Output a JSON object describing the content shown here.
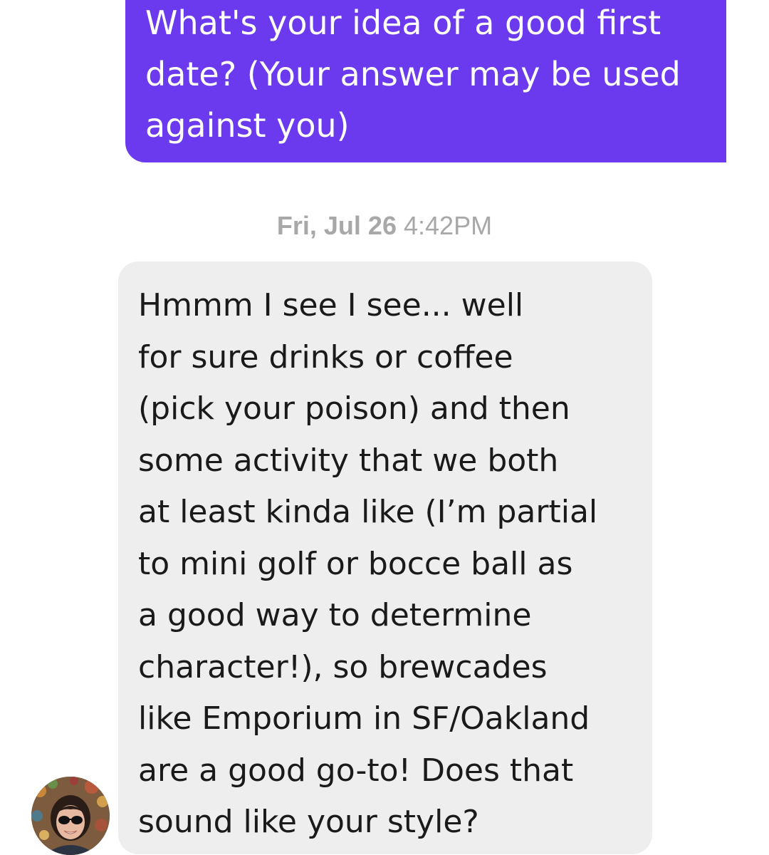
{
  "conversation": {
    "sent_message": {
      "text": "What's your idea of a good first\ndate? (Your answer may be used\nagainst you)"
    },
    "timestamp": {
      "date": "Fri, Jul 26",
      "time": "4:42PM"
    },
    "received_message": {
      "text": "Hmmm I see I see... well\nfor sure drinks or coffee\n(pick your poison) and then\nsome activity that we both\nat least kinda like (I’m partial\nto mini golf or bocce ball as\na good way to determine\ncharacter!), so brewcades\nlike Emporium in SF/Oakland\nare a good go-to! Does that\nsound like your style?"
    },
    "avatar": {
      "icon": "profile-photo"
    }
  },
  "colors": {
    "sent_bubble": "#6b3aef",
    "received_bubble": "#eeeeee",
    "timestamp_text": "#a8a8a8"
  }
}
